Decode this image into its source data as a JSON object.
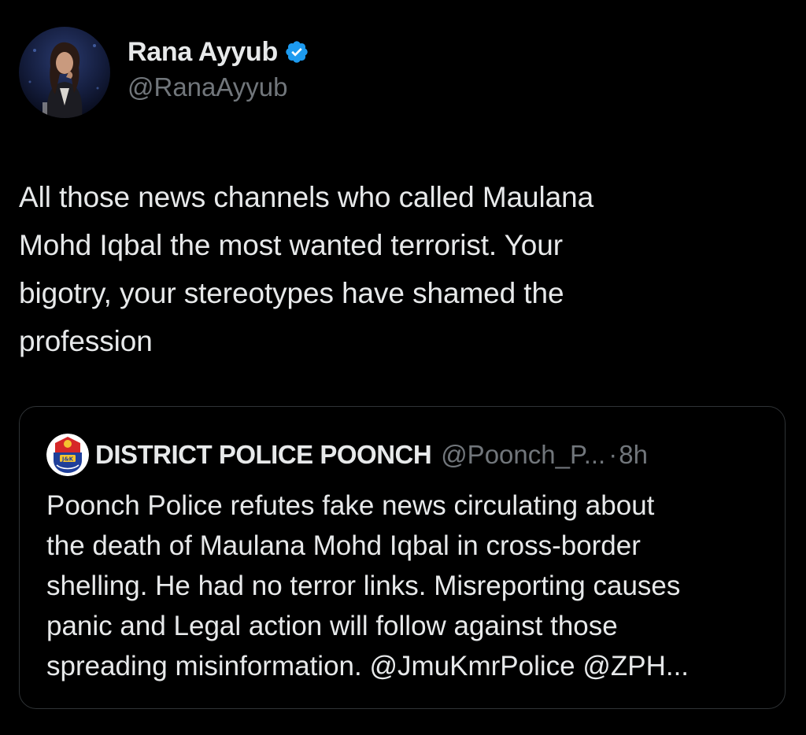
{
  "tweet": {
    "author": {
      "display_name": "Rana Ayyub",
      "handle": "@RanaAyyub",
      "verified": true,
      "avatar_icon": "profile-photo"
    },
    "text": "All those news channels who called Maulana\nMohd Iqbal the most wanted terrorist. Your\nbigotry, your stereotypes have shamed the\nprofession"
  },
  "quoted_tweet": {
    "author": {
      "display_name": "DISTRICT POLICE POONCH",
      "handle": "@Poonch_P...",
      "avatar_icon": "jk-police-emblem"
    },
    "separator": "·",
    "time": "8h",
    "text": "Poonch Police refutes fake news circulating about\nthe death of Maulana Mohd Iqbal in cross-border\nshelling. He had no terror links. Misreporting causes\npanic and Legal action will follow against those\nspreading misinformation. @JmuKmrPolice @ZPH..."
  },
  "colors": {
    "background": "#000000",
    "text_primary": "#e7e9ea",
    "text_secondary": "#71767b",
    "verified_blue": "#1d9bf0",
    "card_border": "#2f3336"
  }
}
